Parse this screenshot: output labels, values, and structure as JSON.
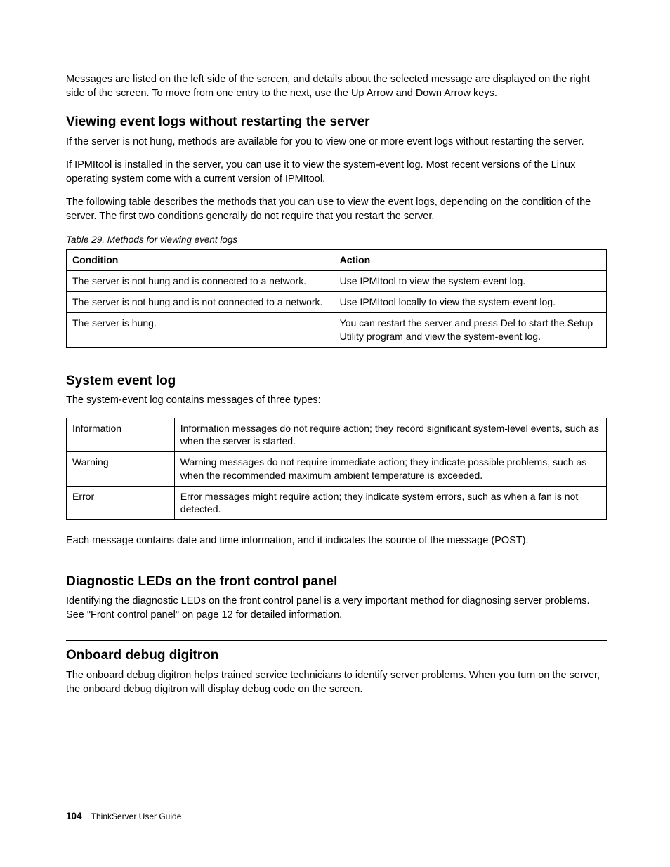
{
  "intro_para": "Messages are listed on the left side of the screen, and details about the selected message are displayed on the right side of the screen. To move from one entry to the next, use the Up Arrow and Down Arrow keys.",
  "sect1": {
    "heading": "Viewing event logs without restarting the server",
    "p1": "If the server is not hung, methods are available for you to view one or more event logs without restarting the server.",
    "p2": "If IPMItool is installed in the server, you can use it to view the system-event log. Most recent versions of the Linux operating system come with a current version of IPMItool.",
    "p3": "The following table describes the methods that you can use to view the event logs, depending on the condition of the server. The first two conditions generally do not require that you restart the server.",
    "table_caption": "Table 29.  Methods for viewing event logs",
    "table": {
      "h1": "Condition",
      "h2": "Action",
      "rows": [
        {
          "c1": "The server is not hung and is connected to a network.",
          "c2": "Use IPMItool to view the system-event log."
        },
        {
          "c1": "The server is not hung and is not connected to a network.",
          "c2": "Use IPMItool locally to view the system-event log."
        },
        {
          "c1": "The server is hung.",
          "c2": "You can restart the server and press Del to start the Setup Utility program and view the system-event log."
        }
      ]
    }
  },
  "sect2": {
    "heading": "System event log",
    "p1": "The system-event log contains messages of three types:",
    "table": {
      "rows": [
        {
          "c1": "Information",
          "c2": "Information messages do not require action; they record significant system-level events, such as when the server is started."
        },
        {
          "c1": "Warning",
          "c2": "Warning messages do not require immediate action; they indicate possible problems, such as when the recommended maximum ambient temperature is exceeded."
        },
        {
          "c1": "Error",
          "c2": "Error messages might require action; they indicate system errors, such as when a fan is not detected."
        }
      ]
    },
    "p2": "Each message contains date and time information, and it indicates the source of the message (POST)."
  },
  "sect3": {
    "heading": "Diagnostic LEDs on the front control panel",
    "p1": "Identifying the diagnostic LEDs on the front control panel is a very important method for diagnosing server problems. See \"Front control panel\" on page 12 for detailed information."
  },
  "sect4": {
    "heading": "Onboard debug digitron",
    "p1": "The onboard debug digitron helps trained service technicians to identify server problems. When you turn on the server, the onboard debug digitron will display debug code on the screen."
  },
  "footer": {
    "page_number": "104",
    "doc_title": "ThinkServer User Guide"
  }
}
